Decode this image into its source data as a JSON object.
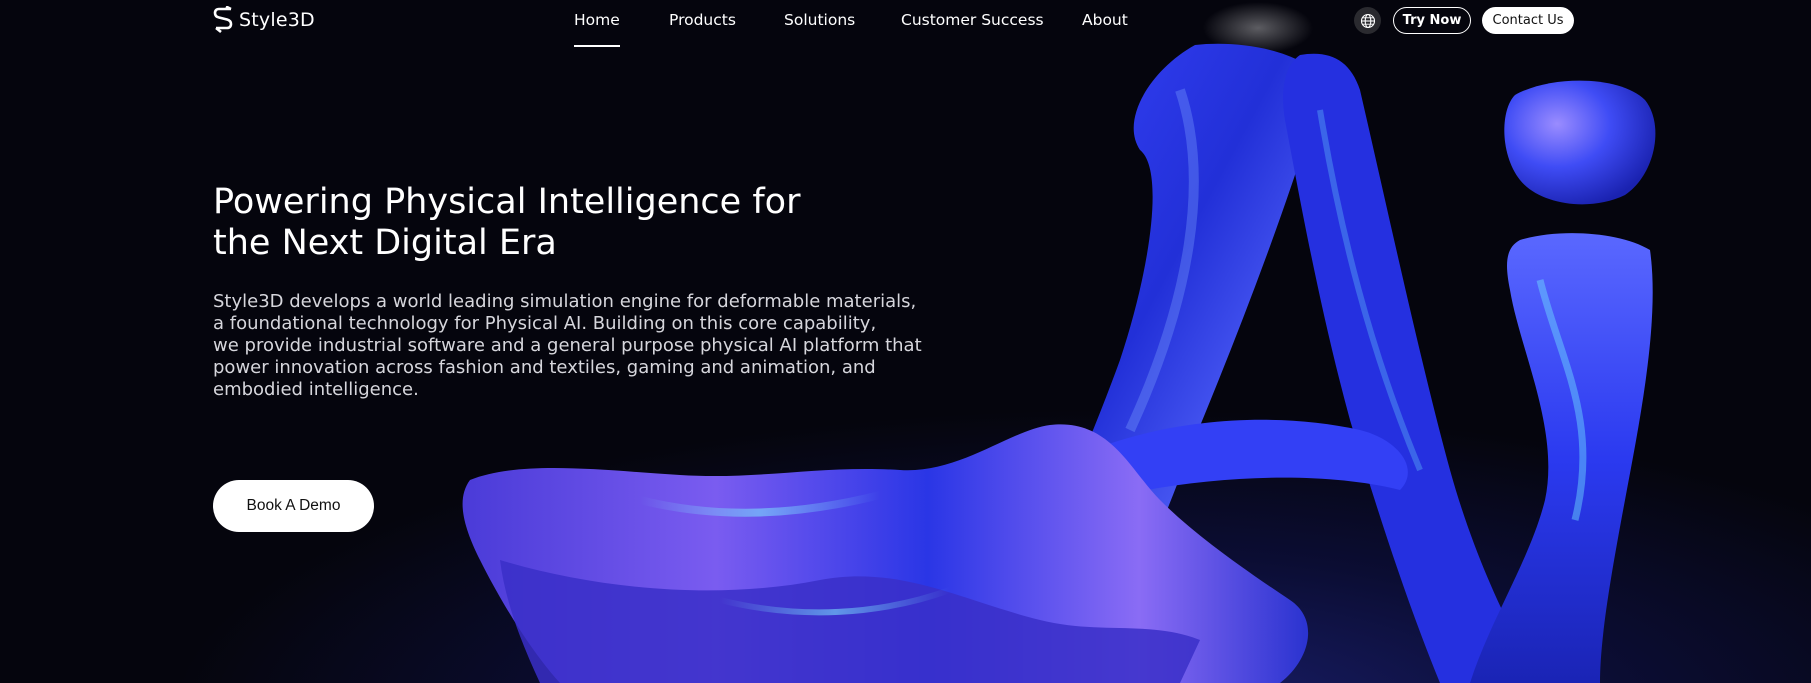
{
  "brand": {
    "name": "Style3D",
    "logo_icon": "style3d-s-logo-icon"
  },
  "nav": {
    "links": [
      {
        "label": "Home",
        "active": true
      },
      {
        "label": "Products",
        "active": false
      },
      {
        "label": "Solutions",
        "active": false
      },
      {
        "label": "Customer Success",
        "active": false
      },
      {
        "label": "About",
        "active": false
      }
    ],
    "language_icon": "globe-icon",
    "try_now_label": "Try Now",
    "contact_label": "Contact Us"
  },
  "hero": {
    "title": "Powering Physical Intelligence for the Next Digital Era",
    "description": "Style3D develops a world leading simulation engine for deformable materials,\na foundational technology for Physical AI. Building on this core capability,\nwe provide industrial software and a general purpose physical AI platform that\npower innovation across fashion and textiles, gaming and animation, and\nembodied intelligence.",
    "cta_label": "Book A Demo"
  },
  "colors": {
    "background": "#05050d",
    "accent_blue": "#2f3cf2",
    "accent_violet": "#9a5cf5",
    "accent_cyan": "#4fd6f0"
  }
}
